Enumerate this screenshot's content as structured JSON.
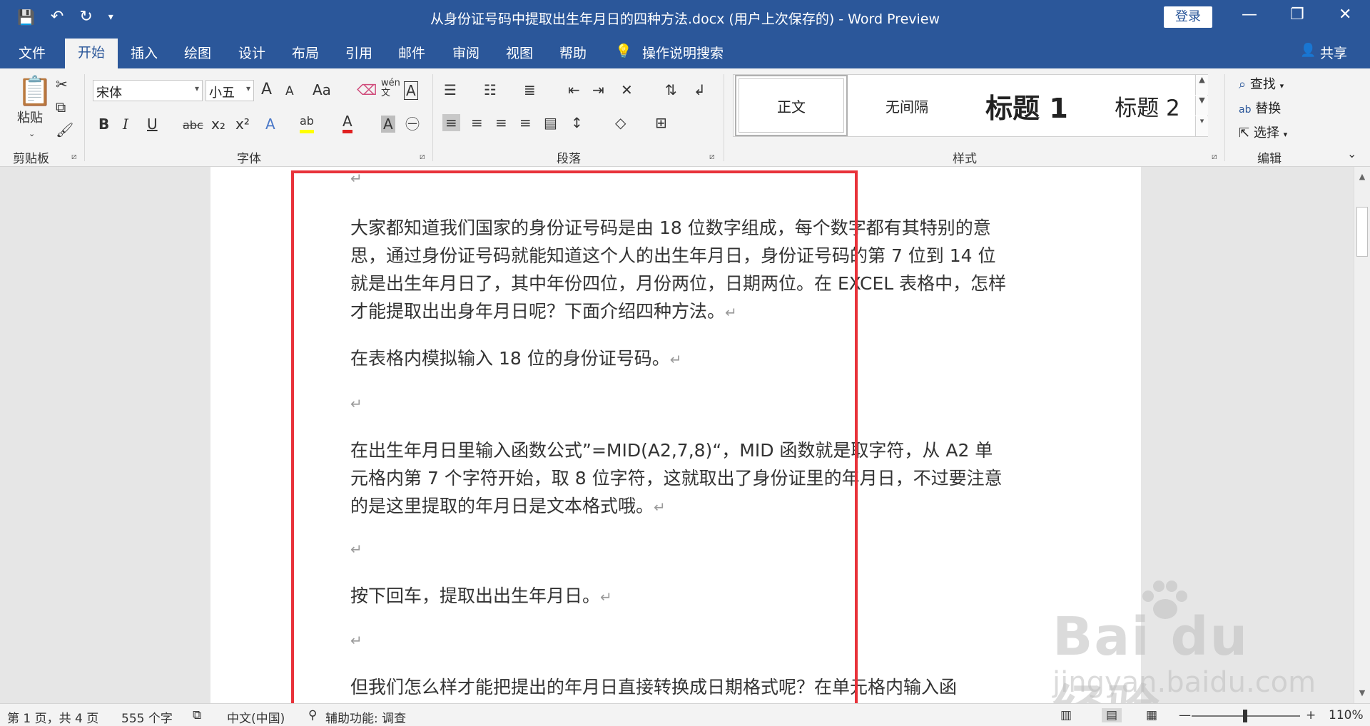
{
  "window": {
    "title": "从身份证号码中提取出生年月日的四种方法.docx (用户上次保存的)  -  Word Preview",
    "login_label": "登录",
    "minimize_glyph": "—",
    "restore_glyph": "❐",
    "close_glyph": "✕"
  },
  "qat": {
    "save_glyph": "💾",
    "undo_glyph": "↶",
    "redo_glyph": "↻",
    "customize_glyph": "▾"
  },
  "tabs": [
    {
      "label": "文件"
    },
    {
      "label": "开始"
    },
    {
      "label": "插入"
    },
    {
      "label": "绘图"
    },
    {
      "label": "设计"
    },
    {
      "label": "布局"
    },
    {
      "label": "引用"
    },
    {
      "label": "邮件"
    },
    {
      "label": "审阅"
    },
    {
      "label": "视图"
    },
    {
      "label": "帮助"
    }
  ],
  "tell_me": "操作说明搜索",
  "share_label": "共享",
  "ribbon": {
    "clipboard": {
      "label": "剪贴板",
      "paste_label": "粘贴"
    },
    "font": {
      "label": "字体",
      "font_name": "宋体",
      "font_size": "小五",
      "grow": "A",
      "shrink": "A",
      "case": "Aa",
      "bold": "B",
      "italic": "I",
      "underline": "U",
      "strike": "abc",
      "sub": "x₂",
      "sup": "x²",
      "wen": "wén 文",
      "border_a": "A"
    },
    "paragraph": {
      "label": "段落"
    },
    "styles": {
      "label": "样式",
      "items": [
        {
          "label": "正文"
        },
        {
          "label": "无间隔"
        },
        {
          "label": "标题 1"
        },
        {
          "label": "标题 2"
        }
      ]
    },
    "editing": {
      "label": "编辑",
      "find": "查找",
      "replace": "替换",
      "select": "选择"
    }
  },
  "document": {
    "paragraphs": [
      {
        "text": "大家都知道我们国家的身份证号码是由 18 位数字组成，每个数字都有其特别的意思，通过身份证号码就能知道这个人的出生年月日，身份证号码的第 7 位到 14 位就是出生年月日了，其中年份四位，月份两位，日期两位。在 EXCEL 表格中，怎样才能提取出出身年月日呢？下面介绍四种方法。"
      },
      {
        "text": "在表格内模拟输入 18 位的身份证号码。"
      },
      {
        "text": "在出生年月日里输入函数公式”=MID(A2,7,8)“，MID 函数就是取字符，从 A2 单元格内第 7 个字符开始，取 8 位字符，这就取出了身份证里的年月日，不过要注意的是这里提取的年月日是文本格式哦。"
      },
      {
        "text": "按下回车，提取出出生年月日。"
      },
      {
        "text": "但我们怎么样才能把提出的年月日直接转换成日期格式呢？在单元格内输入函"
      }
    ],
    "para_mark": "↵"
  },
  "status": {
    "page": "第 1 页，共 4 页",
    "words": "555 个字",
    "language": "中文(中国)",
    "accessibility": "辅助功能: 调查",
    "zoom": "110%",
    "zoom_minus": "—",
    "zoom_plus": "+"
  },
  "watermark": {
    "brand": "Bai du 经验",
    "url": "jingyan.baidu.com"
  }
}
